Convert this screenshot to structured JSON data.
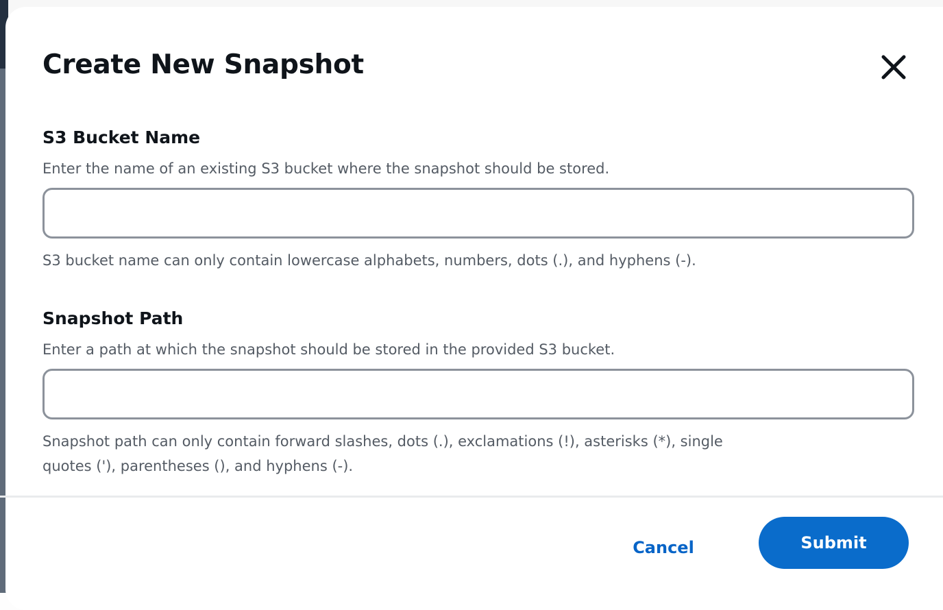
{
  "modal": {
    "title": "Create New Snapshot",
    "close_icon": "close-icon"
  },
  "fields": [
    {
      "label": "S3 Bucket Name",
      "description": "Enter the name of an existing S3 bucket where the snapshot should be stored.",
      "value": "",
      "constraint_lines": [
        "S3 bucket name can only contain lowercase alphabets, numbers, dots (.), and hyphens (-)."
      ]
    },
    {
      "label": "Snapshot Path",
      "description": "Enter a path at which the snapshot should be stored in the provided S3 bucket.",
      "value": "",
      "constraint_lines": [
        "Snapshot path can only contain forward slashes, dots (.), exclamations (!), asterisks (*), single",
        "quotes ('), parentheses (), and hyphens (-)."
      ]
    }
  ],
  "footer": {
    "cancel_label": "Cancel",
    "submit_label": "Submit"
  },
  "colors": {
    "primary": "#0a6ccb",
    "link": "#0764c7",
    "heading": "#0f141a",
    "secondary_text": "#545b64",
    "input_border": "#8c929b"
  }
}
